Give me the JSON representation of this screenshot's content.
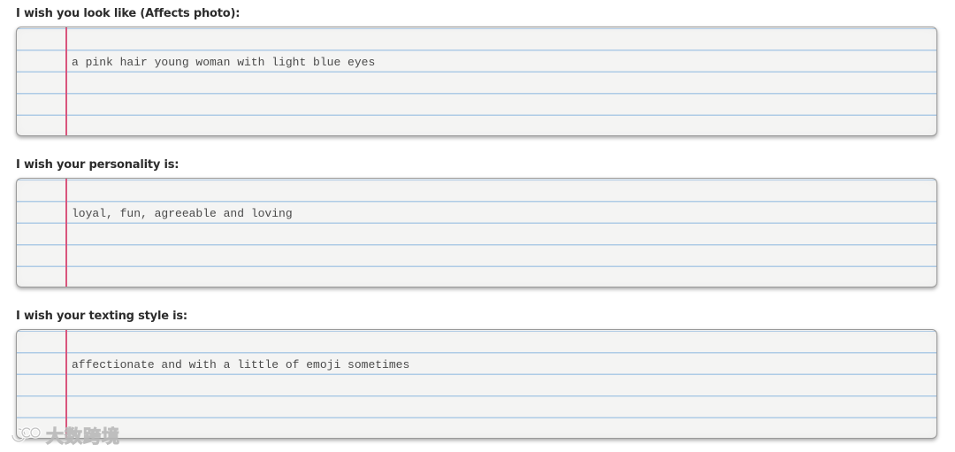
{
  "fields": [
    {
      "label": "I wish you look like (Affects photo):",
      "value": "a pink hair young woman with light blue eyes"
    },
    {
      "label": "I wish your personality is:",
      "value": "loyal, fun, agreeable and loving"
    },
    {
      "label": "I wish your texting style is:",
      "value": "affectionate and with a little of emoji sometimes"
    }
  ],
  "watermark": {
    "text": "大数跨境"
  },
  "colors": {
    "paper": "#f4f4f3",
    "rule_line": "#aecbe6",
    "margin_line": "#d9557c",
    "label_text": "#2c2c2c",
    "body_text": "#4a4a4a"
  }
}
